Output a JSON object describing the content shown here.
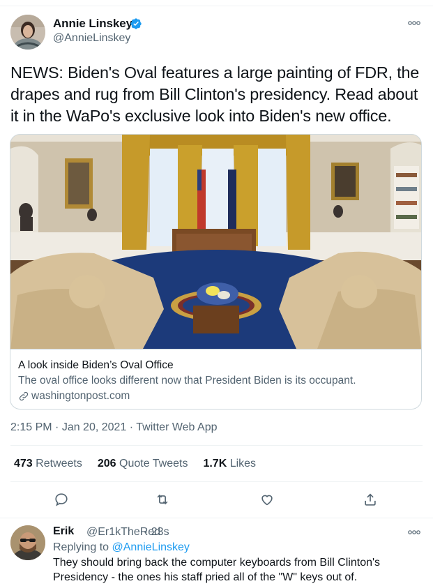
{
  "tweet": {
    "author_name": "Annie Linskey",
    "author_handle": "@AnnieLinskey",
    "text": "NEWS: Biden's Oval features a large painting of FDR, the drapes and rug from Bill Clinton's presidency. Read about it in the WaPo's exclusive look into Biden's new office.",
    "card": {
      "title": "A look inside Biden’s Oval Office",
      "description": "The oval office looks different now that President Biden is its occupant.",
      "domain": "washingtonpost.com"
    },
    "time": "2:15 PM",
    "date": "Jan 20, 2021",
    "source": "Twitter Web App",
    "separator": " · ",
    "stats": {
      "retweets_count": "473",
      "retweets_label": "Retweets",
      "quotes_count": "206",
      "quotes_label": "Quote Tweets",
      "likes_count": "1.7K",
      "likes_label": "Likes"
    },
    "actions": [
      "reply-icon",
      "retweet-icon",
      "like-icon",
      "share-icon"
    ],
    "verified_icon": "verified-badge-icon",
    "more_icon": "more-options-icon"
  },
  "reply": {
    "author_name": "Erik",
    "author_handle": "@Er1kTheRed",
    "time": "· 23s",
    "replying_prefix": "Replying to",
    "replying_to": "@AnnieLinskey",
    "text": "They should bring back the computer keyboards from Bill Clinton's Presidency - the ones his staff pried all of the \"W\" keys out of."
  },
  "colors": {
    "accent": "#1d9bf0",
    "text": "#0f1419",
    "secondary": "#536471",
    "border": "#cfd9de"
  }
}
